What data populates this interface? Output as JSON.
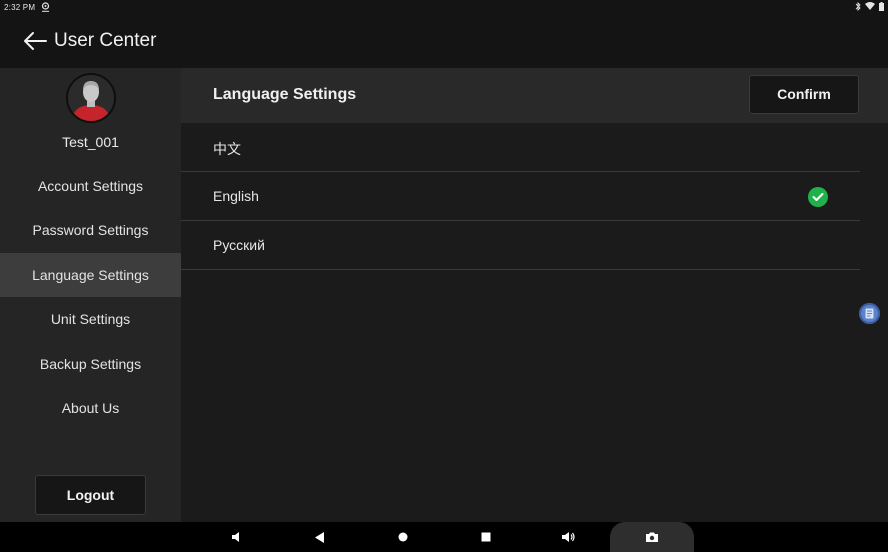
{
  "status_bar": {
    "time": "2:32 PM"
  },
  "app_bar": {
    "title": "User Center"
  },
  "sidebar": {
    "username": "Test_001",
    "items": [
      {
        "label": "Account Settings",
        "active": false
      },
      {
        "label": "Password Settings",
        "active": false
      },
      {
        "label": "Language Settings",
        "active": true
      },
      {
        "label": "Unit Settings",
        "active": false
      },
      {
        "label": "Backup Settings",
        "active": false
      },
      {
        "label": "About Us",
        "active": false
      }
    ],
    "logout_label": "Logout"
  },
  "content": {
    "title": "Language Settings",
    "confirm_label": "Confirm",
    "languages": [
      {
        "label": "中文",
        "selected": false
      },
      {
        "label": "English",
        "selected": true
      },
      {
        "label": "Русский",
        "selected": false
      }
    ]
  },
  "icons": {
    "back": "arrow-left-icon",
    "check": "check-circle-icon",
    "float": "floating-assist-icon",
    "nav": [
      "volume-down-icon",
      "back-triangle-icon",
      "home-circle-icon",
      "recents-square-icon",
      "volume-up-icon",
      "camera-icon"
    ]
  },
  "colors": {
    "accent_check": "#21b14b",
    "active_menu_bg": "#3e3d3e",
    "sidebar_bg": "#262526",
    "content_bg": "#1c1b1c"
  }
}
